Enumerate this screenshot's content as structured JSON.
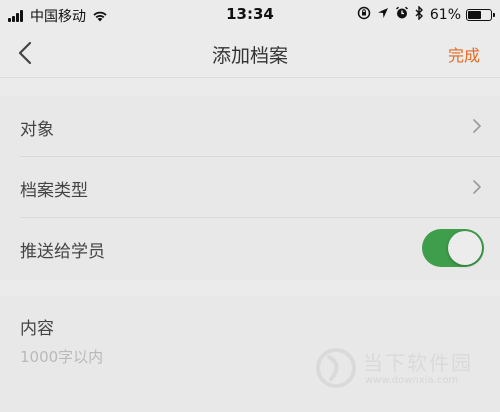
{
  "status_bar": {
    "carrier": "中国移动",
    "time": "13:34",
    "battery_percent": "61%",
    "battery_level": 0.61,
    "icons": [
      "signal-icon",
      "wifi-icon",
      "rotation-lock-icon",
      "location-icon",
      "alarm-icon",
      "bluetooth-icon",
      "battery-icon"
    ]
  },
  "nav": {
    "title": "添加档案",
    "done_label": "完成",
    "done_color": "#e56a21"
  },
  "rows": [
    {
      "label": "对象",
      "accessory": "chevron-right-icon"
    },
    {
      "label": "档案类型",
      "accessory": "chevron-right-icon"
    },
    {
      "label": "推送给学员",
      "accessory": "toggle",
      "toggle_on": true,
      "toggle_color": "#3f9e4b"
    }
  ],
  "content": {
    "label": "内容",
    "value": "",
    "placeholder": "1000字以内"
  },
  "watermark": {
    "text": "当下软件园",
    "url": "www.downxia.com"
  }
}
